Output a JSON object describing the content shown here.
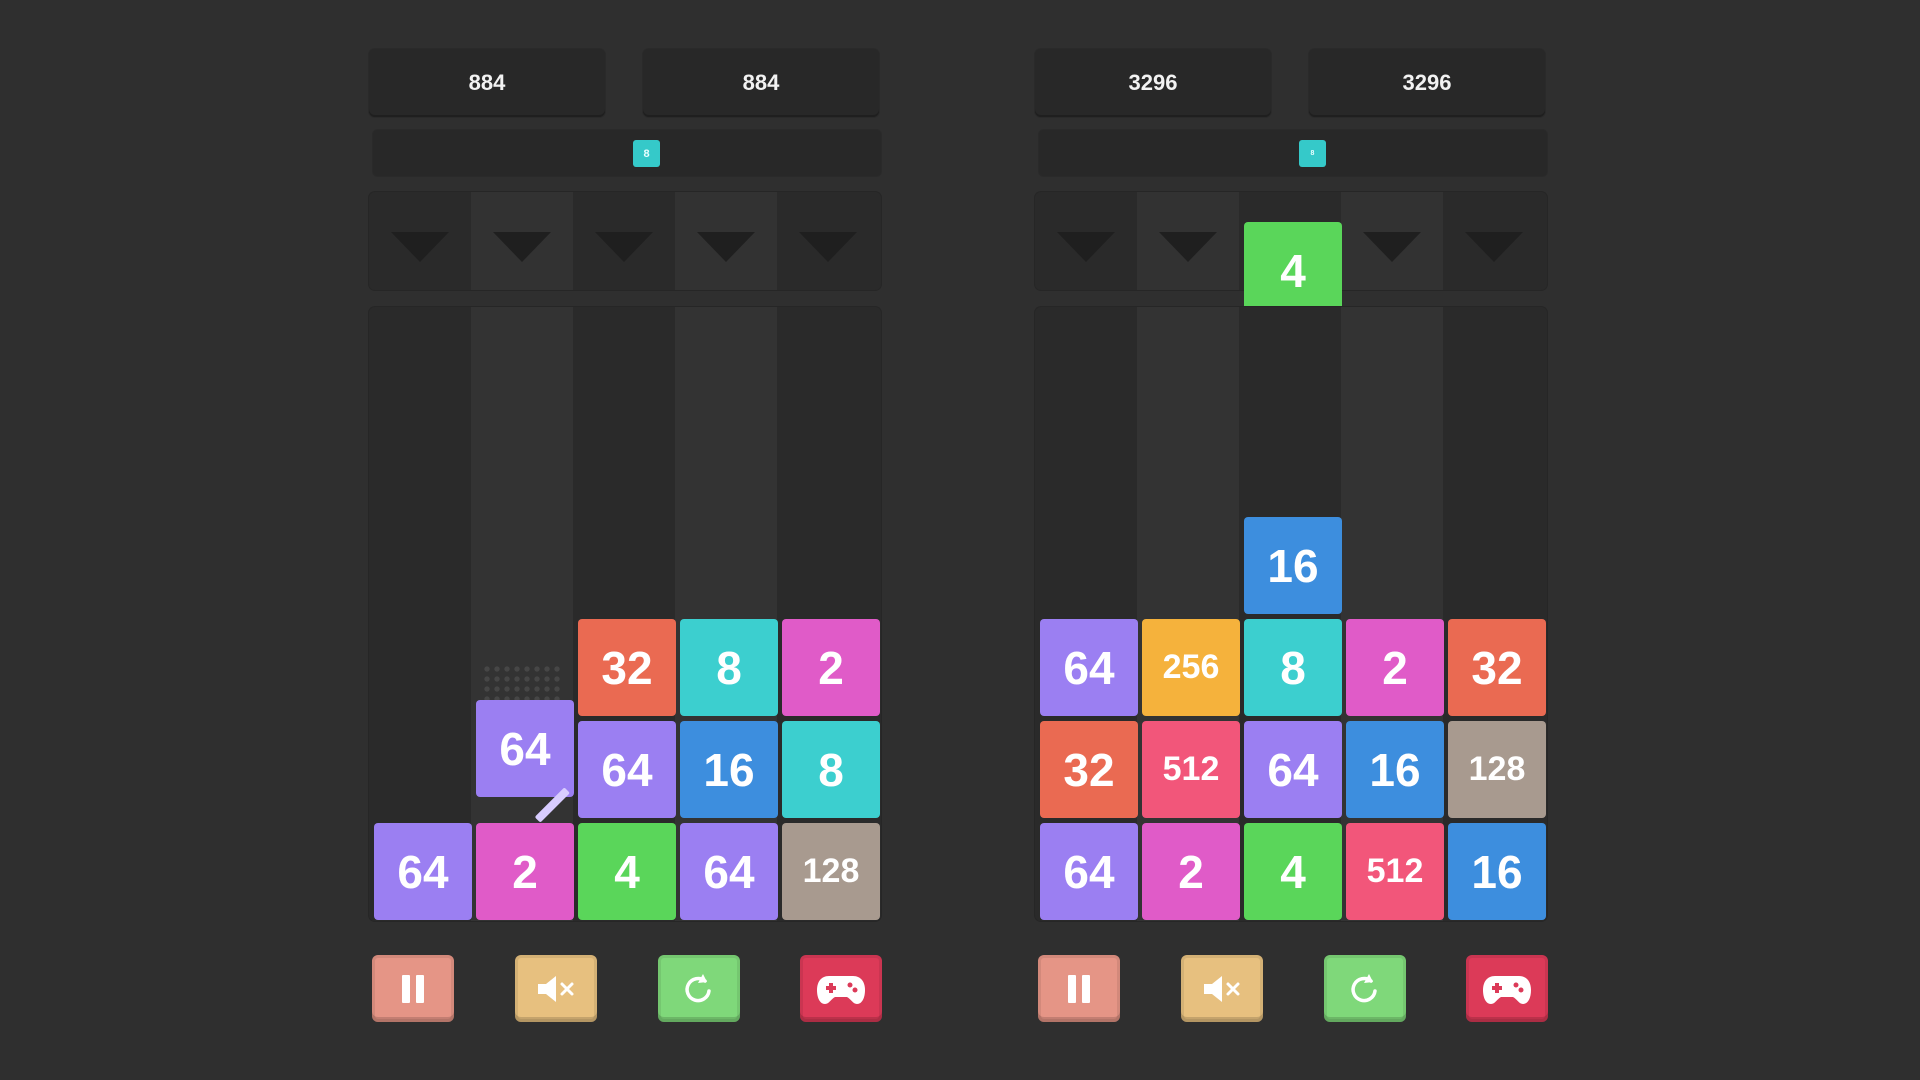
{
  "colors": {
    "background": "#2f2f2f",
    "tile_2": "#e05bc8",
    "tile_4": "#5ad65a",
    "tile_8": "#3ccfcf",
    "tile_16": "#3d8ede",
    "tile_32": "#ea6a52",
    "tile_64": "#9b7ff2",
    "tile_128": "#a89a8f",
    "tile_256": "#f5b23c",
    "tile_512": "#f2567a"
  },
  "left": {
    "score": "884",
    "best": "884",
    "next_tile": "8",
    "grid": [
      [
        "",
        "",
        "",
        "",
        ""
      ],
      [
        "",
        "",
        "",
        "",
        ""
      ],
      [
        "",
        "",
        "",
        "",
        ""
      ],
      [
        "",
        "",
        "32",
        "8",
        "2"
      ],
      [
        "",
        "64",
        "64",
        "16",
        "8"
      ],
      [
        "64",
        "2",
        "4",
        "64",
        "128"
      ]
    ]
  },
  "right": {
    "score": "3296",
    "best": "3296",
    "next_tile": "8",
    "current_tile": "4",
    "grid": [
      [
        "",
        "",
        "",
        "",
        ""
      ],
      [
        "",
        "",
        "",
        "",
        ""
      ],
      [
        "",
        "",
        "16",
        "",
        ""
      ],
      [
        "64",
        "256",
        "8",
        "2",
        "32"
      ],
      [
        "32",
        "512",
        "64",
        "16",
        "128"
      ],
      [
        "64",
        "2",
        "4",
        "512",
        "16"
      ]
    ]
  },
  "icons": {
    "pause": "pause-icon",
    "mute": "speaker-muted-icon",
    "restart": "restart-icon",
    "games": "gamepad-icon"
  }
}
